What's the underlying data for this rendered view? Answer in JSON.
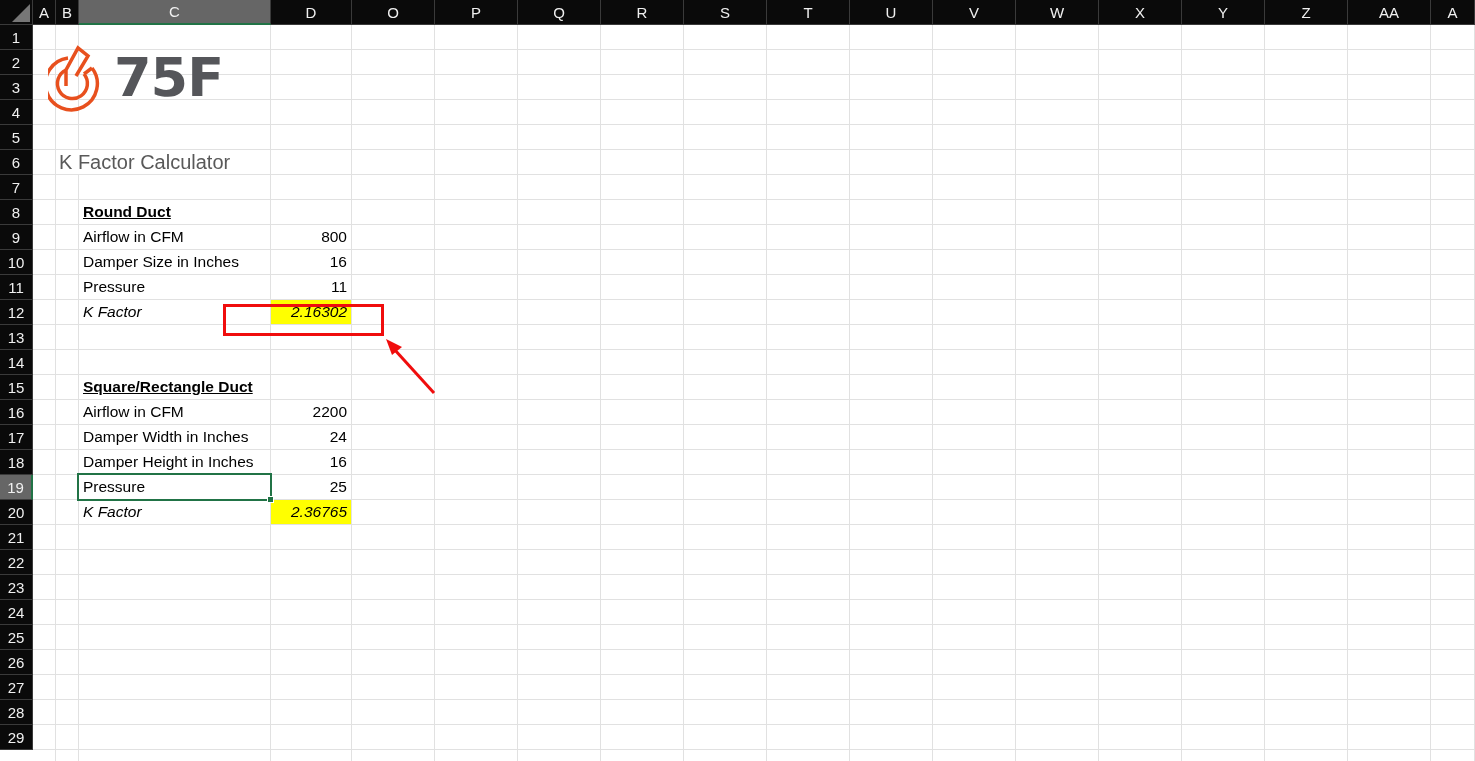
{
  "columns": [
    {
      "label": "A",
      "selected": false
    },
    {
      "label": "B",
      "selected": false
    },
    {
      "label": "C",
      "selected": true
    },
    {
      "label": "D",
      "selected": false
    },
    {
      "label": "O",
      "selected": false
    },
    {
      "label": "P",
      "selected": false
    },
    {
      "label": "Q",
      "selected": false
    },
    {
      "label": "R",
      "selected": false
    },
    {
      "label": "S",
      "selected": false
    },
    {
      "label": "T",
      "selected": false
    },
    {
      "label": "U",
      "selected": false
    },
    {
      "label": "V",
      "selected": false
    },
    {
      "label": "W",
      "selected": false
    },
    {
      "label": "X",
      "selected": false
    },
    {
      "label": "Y",
      "selected": false
    },
    {
      "label": "Z",
      "selected": false
    },
    {
      "label": "AA",
      "selected": false
    },
    {
      "label": "A",
      "selected": false
    }
  ],
  "logo": {
    "text": "75F"
  },
  "rows": [
    {
      "number": "1",
      "selected": false
    },
    {
      "number": "2",
      "selected": false
    },
    {
      "number": "3",
      "selected": false
    },
    {
      "number": "4",
      "selected": false
    },
    {
      "number": "5",
      "selected": false
    },
    {
      "number": "6",
      "selected": false,
      "kind": "title",
      "label": "K Factor Calculator"
    },
    {
      "number": "7",
      "selected": false
    },
    {
      "number": "8",
      "selected": false,
      "kind": "heading",
      "label": "Round Duct"
    },
    {
      "number": "9",
      "selected": false,
      "kind": "field",
      "label": "Airflow in CFM",
      "value": "800"
    },
    {
      "number": "10",
      "selected": false,
      "kind": "field",
      "label": "Damper Size in Inches",
      "value": "16"
    },
    {
      "number": "11",
      "selected": false,
      "kind": "field",
      "label": "Pressure",
      "value": "11"
    },
    {
      "number": "12",
      "selected": false,
      "kind": "result",
      "label": "K Factor",
      "value": "2.16302",
      "highlighted": true
    },
    {
      "number": "13",
      "selected": false
    },
    {
      "number": "14",
      "selected": false
    },
    {
      "number": "15",
      "selected": false,
      "kind": "heading",
      "label": "Square/Rectangle Duct"
    },
    {
      "number": "16",
      "selected": false,
      "kind": "field",
      "label": "Airflow in CFM",
      "value": "2200"
    },
    {
      "number": "17",
      "selected": false,
      "kind": "field",
      "label": "Damper Width in Inches",
      "value": "24"
    },
    {
      "number": "18",
      "selected": false,
      "kind": "field",
      "label": "Damper Height in Inches",
      "value": "16"
    },
    {
      "number": "19",
      "selected": true,
      "kind": "field",
      "label": "Pressure",
      "value": "25"
    },
    {
      "number": "20",
      "selected": false,
      "kind": "result",
      "label": "K Factor",
      "value": "2.36765",
      "highlighted": true
    },
    {
      "number": "21",
      "selected": false
    },
    {
      "number": "22",
      "selected": false
    },
    {
      "number": "23",
      "selected": false
    },
    {
      "number": "24",
      "selected": false
    },
    {
      "number": "25",
      "selected": false
    },
    {
      "number": "26",
      "selected": false
    },
    {
      "number": "27",
      "selected": false
    },
    {
      "number": "28",
      "selected": false
    },
    {
      "number": "29",
      "selected": false
    }
  ]
}
